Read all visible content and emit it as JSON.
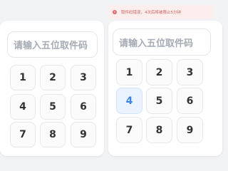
{
  "toast": {
    "text": "取件码错误，4次后将被限止5分钟"
  },
  "left": {
    "placeholder": "请输入五位取件码",
    "keys": [
      "1",
      "2",
      "3",
      "4",
      "5",
      "6",
      "7",
      "8",
      "9"
    ]
  },
  "right": {
    "placeholder": "请输入五位取件码",
    "keys": [
      "1",
      "2",
      "3",
      "4",
      "5",
      "6",
      "7",
      "8",
      "9"
    ],
    "active_key": "4"
  },
  "colors": {
    "accent": "#3b84e6",
    "error": "#e26a6a",
    "error_bg": "#fdeeee"
  }
}
